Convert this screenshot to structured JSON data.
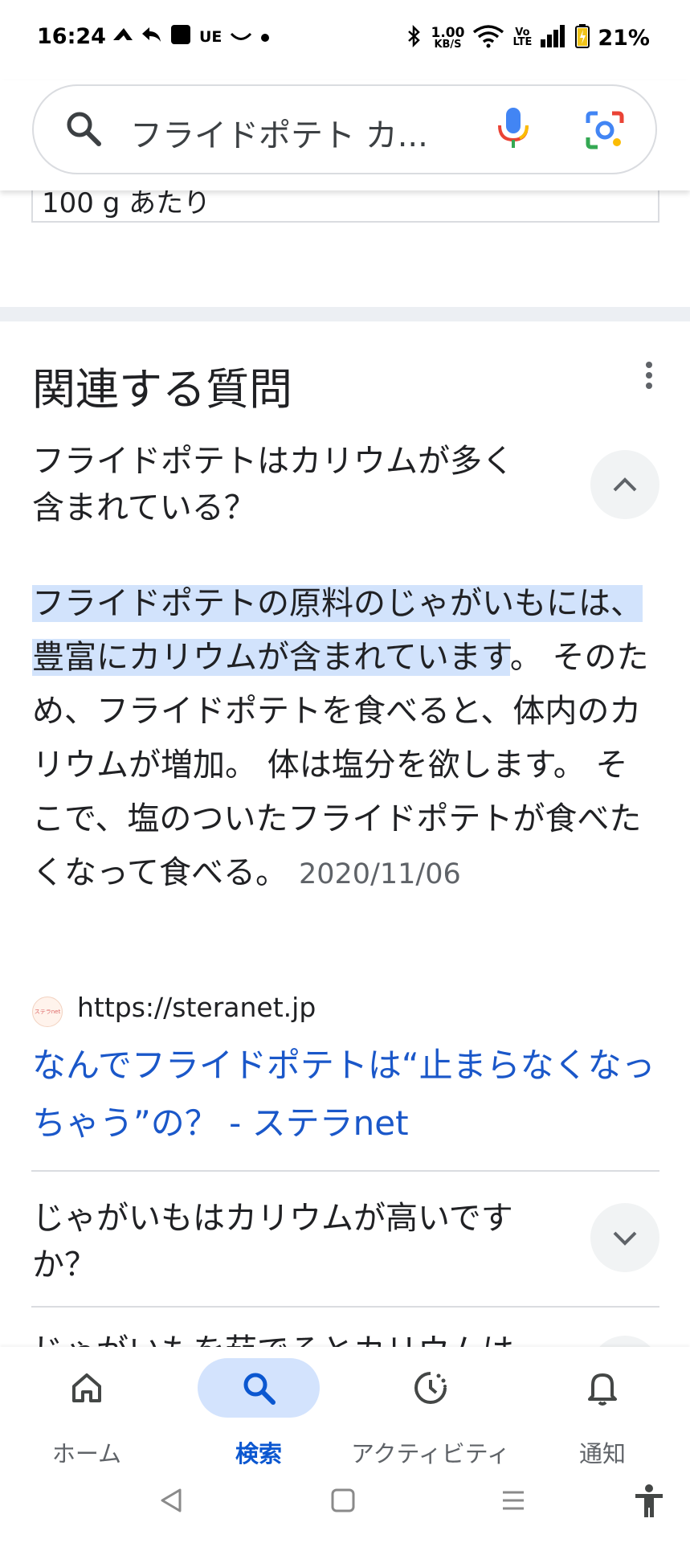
{
  "status_bar": {
    "time": "16:24",
    "left_icons": [
      "navigation-arrow-icon",
      "reply-arrow-icon",
      "app-square-icon",
      "UE",
      "smile-icon",
      "dot-icon"
    ],
    "ue_text": "UE",
    "speed_value": "1.00",
    "speed_unit": "KB/S",
    "volte_line1": "Vo",
    "volte_line2": "LTE",
    "battery": "21%"
  },
  "search": {
    "query": "フライドポテト カ..."
  },
  "top_box": {
    "text": "100 g あたり"
  },
  "related": {
    "title": "関連する質問",
    "items": [
      {
        "question_line1": "フライドポテトはカリウムが多く",
        "question_line2": "含まれている？",
        "expanded": true,
        "answer_highlight": "フライドポテトの原料のじゃがいもには、豊富にカリウムが含まれています",
        "answer_rest": "。 そのため、フライドポテトを食べると、体内のカリウムが増加。 体は塩分を欲します。 そこで、塩のついたフライドポテトが食べたくなって食べる。",
        "date": "2020/11/06",
        "favicon_text": "ステラnet",
        "source_url": "https://steranet.jp",
        "source_title": "なんでフライドポテトは“止まらなくなっちゃう”の？ - ステラnet"
      },
      {
        "question_line1": "じゃがいもはカリウムが高いです",
        "question_line2": "か？",
        "expanded": false
      },
      {
        "question_line1": "じゃがいもを茹でるとカリウムは",
        "expanded": false
      }
    ]
  },
  "bottom_nav": {
    "items": [
      {
        "label": "ホーム",
        "icon": "home-icon",
        "active": false
      },
      {
        "label": "検索",
        "icon": "search-icon",
        "active": true
      },
      {
        "label": "アクティビティ",
        "icon": "activity-icon",
        "active": false
      },
      {
        "label": "通知",
        "icon": "bell-icon",
        "active": false
      }
    ]
  },
  "colors": {
    "link": "#1a57c9",
    "highlight": "#d2e3fc",
    "active_nav": "#0b57d0",
    "active_pill": "#d3e3fd"
  }
}
